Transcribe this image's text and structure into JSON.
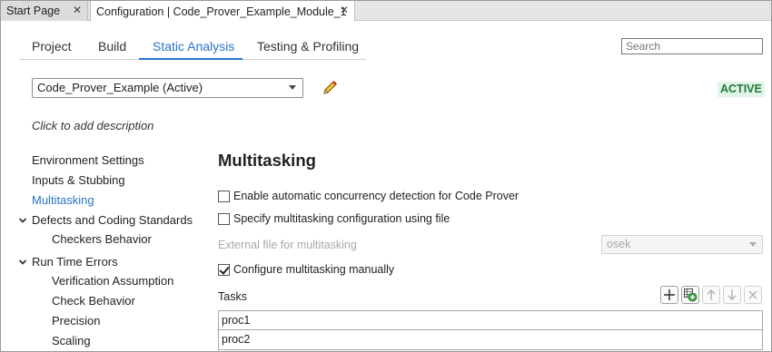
{
  "doc_tabs": [
    {
      "label": "Start Page"
    },
    {
      "label": "Configuration | Code_Prover_Example_Module_1"
    }
  ],
  "nav_tabs": [
    {
      "label": "Project"
    },
    {
      "label": "Build"
    },
    {
      "label": "Static Analysis",
      "active": true
    },
    {
      "label": "Testing & Profiling"
    }
  ],
  "search": {
    "placeholder": "Search"
  },
  "config": {
    "selected": "Code_Prover_Example (Active)",
    "status": "ACTIVE"
  },
  "description": "Click to add description",
  "sidebar": {
    "items": [
      {
        "label": "Environment Settings"
      },
      {
        "label": "Inputs & Stubbing"
      },
      {
        "label": "Multitasking",
        "selected": true
      },
      {
        "label": "Defects and Coding Standards",
        "expanded": true
      },
      {
        "label": "Checkers Behavior"
      },
      {
        "label": "Run Time Errors",
        "expanded": true
      },
      {
        "label": "Verification Assumption"
      },
      {
        "label": "Check Behavior"
      },
      {
        "label": "Precision"
      },
      {
        "label": "Scaling"
      }
    ]
  },
  "main": {
    "title": "Multitasking",
    "options": [
      {
        "label": "Enable automatic concurrency detection for Code Prover",
        "checked": false
      },
      {
        "label": "Specify multitasking configuration using file",
        "checked": false
      }
    ],
    "external_file_label": "External file for multitasking",
    "external_file_value": "osek",
    "manual_option": {
      "label": "Configure multitasking manually",
      "checked": true
    },
    "tasks_label": "Tasks",
    "tasks": [
      "proc1",
      "proc2"
    ]
  },
  "colors": {
    "accent": "#2a74c6",
    "active_badge_bg": "#e2f3e8",
    "active_badge_fg": "#1f7a3b"
  }
}
